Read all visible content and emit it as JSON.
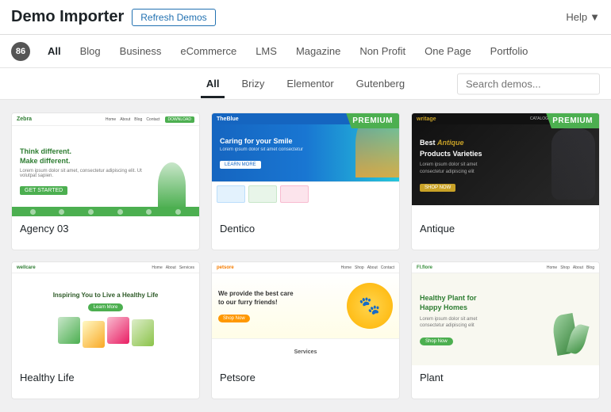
{
  "header": {
    "title": "Demo Importer",
    "refresh_label": "Refresh Demos",
    "help_label": "Help"
  },
  "filter": {
    "count": "86",
    "tabs": [
      {
        "label": "All",
        "active": true
      },
      {
        "label": "Blog"
      },
      {
        "label": "Business"
      },
      {
        "label": "eCommerce"
      },
      {
        "label": "LMS"
      },
      {
        "label": "Magazine"
      },
      {
        "label": "Non Profit"
      },
      {
        "label": "One Page"
      },
      {
        "label": "Portfolio"
      }
    ]
  },
  "sub_filter": {
    "tabs": [
      {
        "label": "All",
        "active": true
      },
      {
        "label": "Brizy"
      },
      {
        "label": "Elementor"
      },
      {
        "label": "Gutenberg"
      }
    ],
    "search_placeholder": "Search demos..."
  },
  "demos": [
    {
      "id": 1,
      "name": "Agency 03",
      "premium": false,
      "theme": "agency"
    },
    {
      "id": 2,
      "name": "Dentico",
      "premium": true,
      "theme": "dentico"
    },
    {
      "id": 3,
      "name": "Antique",
      "premium": true,
      "theme": "antique"
    },
    {
      "id": 4,
      "name": "Healthy Life",
      "premium": false,
      "theme": "healthy"
    },
    {
      "id": 5,
      "name": "Petsore",
      "premium": false,
      "theme": "pets"
    },
    {
      "id": 6,
      "name": "Plant",
      "premium": false,
      "theme": "plant"
    }
  ],
  "premium_badge_label": "PREMIUM"
}
